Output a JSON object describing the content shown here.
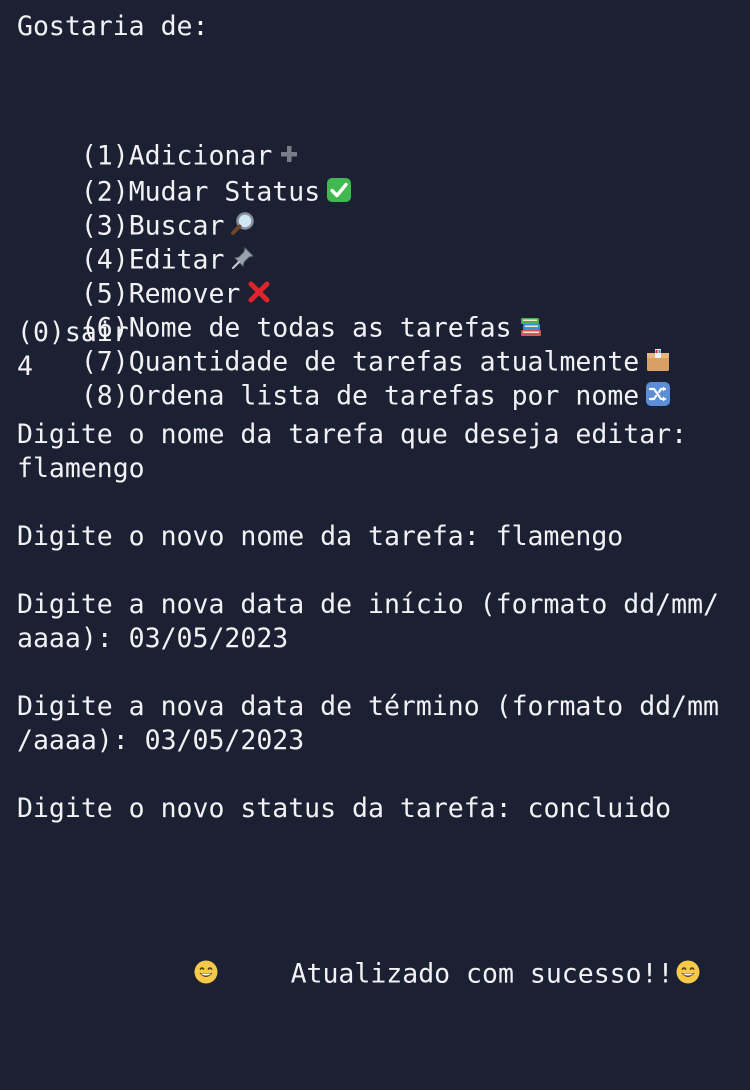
{
  "menu": {
    "title": "Gostaria de:",
    "options": [
      {
        "label": "(1)Adicionar",
        "icon": "plus-icon"
      },
      {
        "label": "(2)Mudar Status",
        "icon": "check-mark-button-icon"
      },
      {
        "label": "(3)Buscar",
        "icon": "magnifying-glass-icon"
      },
      {
        "label": "(4)Editar",
        "icon": "pushpin-icon"
      },
      {
        "label": "(5)Remover",
        "icon": "cross-mark-icon"
      },
      {
        "label": "(6)Nome de todas as tarefas",
        "icon": "books-icon"
      },
      {
        "label": "(7)Quantidade de tarefas atualmente",
        "icon": "package-icon"
      },
      {
        "label": "(8)Ordena lista de tarefas por nome",
        "icon": "shuffle-icon"
      },
      {
        "label": "(0)sair"
      }
    ]
  },
  "session": {
    "choice": "4",
    "prompt_edit_name": "Digite o nome da tarefa que deseja editar:",
    "answer_edit_name": "flamengo",
    "prompt_new_name": "Digite o novo nome da tarefa: flamengo",
    "prompt_start_date_1": "Digite a nova data de início (formato dd/mm/",
    "prompt_start_date_2": "aaaa): 03/05/2023",
    "prompt_end_date_1": "Digite a nova data de término (formato dd/mm",
    "prompt_end_date_2": "/aaaa): 03/05/2023",
    "prompt_status": "Digite o novo status da tarefa: concluido",
    "success_message": "Atualizado com sucesso!!",
    "success_icon": "grinning-face-icon"
  },
  "colors": {
    "background": "#1c2033",
    "text": "#f2f2f5",
    "check_green": "#3fb950",
    "cross_red": "#e0242b"
  }
}
